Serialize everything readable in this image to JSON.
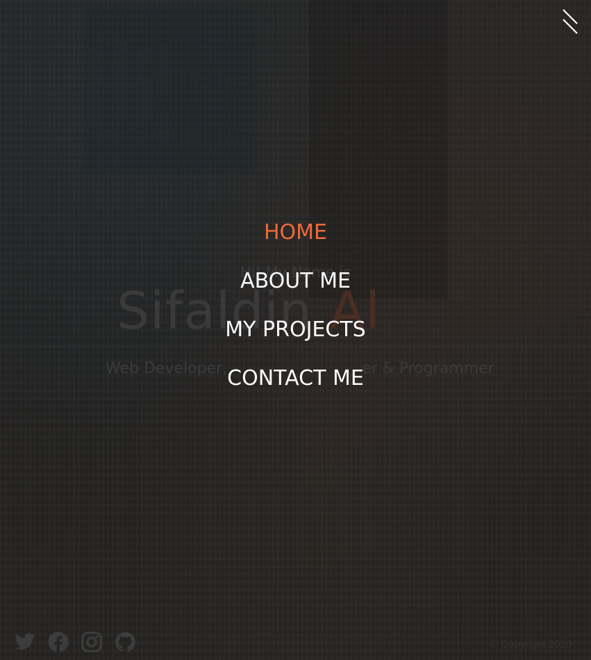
{
  "hero": {
    "greeting": "Hi! My Name is",
    "name_first": "Sifaldin",
    "name_last": "Al",
    "tagline": "Web Developer,",
    "tagline_tail": "er & Programmer"
  },
  "menu_toggle": {
    "icon": "close-icon"
  },
  "nav": {
    "items": [
      {
        "label": "HOME",
        "active": true
      },
      {
        "label": "ABOUT ME",
        "active": false
      },
      {
        "label": "MY PROJECTS",
        "active": false
      },
      {
        "label": "CONTACT ME",
        "active": false
      }
    ],
    "active_color": "#ee6a3b"
  },
  "footer": {
    "social": [
      {
        "icon": "twitter-icon"
      },
      {
        "icon": "facebook-icon"
      },
      {
        "icon": "instagram-icon"
      },
      {
        "icon": "github-icon"
      }
    ],
    "copyright": "© Copyright 2020"
  }
}
